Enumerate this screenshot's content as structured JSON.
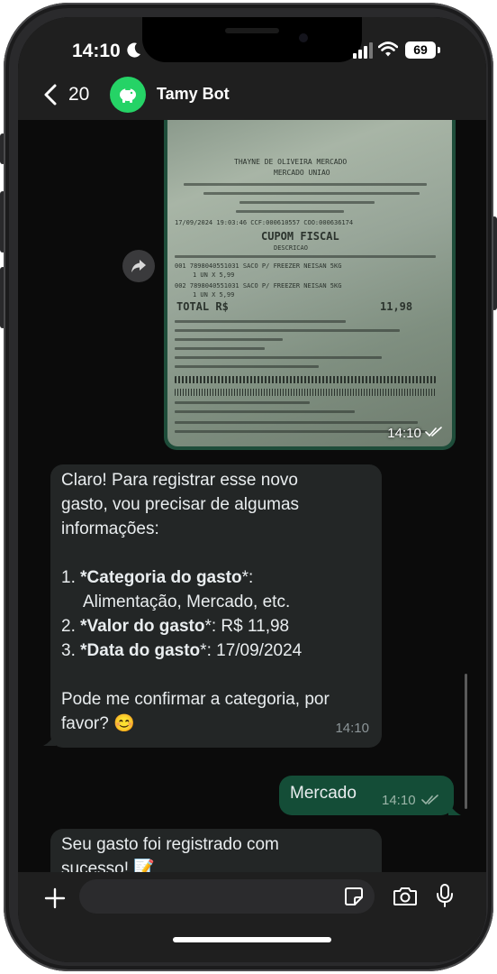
{
  "status_bar": {
    "time": "14:10",
    "battery": "69",
    "icons": [
      "moon-icon",
      "signal-icon",
      "wifi-icon",
      "battery-icon"
    ]
  },
  "header": {
    "back_count": "20",
    "contact_name": "Tamy Bot",
    "icons": [
      "chevron-left-icon",
      "piggy-bank-icon"
    ]
  },
  "messages": {
    "image": {
      "time": "14:10",
      "status": "read"
    },
    "bot_reply_1": {
      "intro_1": "Claro! Para registrar esse novo",
      "intro_2": "gasto, vou precisar de algumas",
      "intro_3": "informações:",
      "item1_num": "1.",
      "item1_label": "*Categoria do gasto",
      "item1_suffix": "*:",
      "item1_detail": "Alimentação, Mercado, etc.",
      "item2_num": "2.",
      "item2_label": "*Valor do gasto",
      "item2_suffix": "*: R$ 11,98",
      "item3_num": "3.",
      "item3_label": "*Data do gasto",
      "item3_suffix": "*: 17/09/2024",
      "question_1": "Pode me confirmar a categoria, por",
      "question_2": "favor? 😊",
      "time": "14:10"
    },
    "user_reply": {
      "text": "Mercado",
      "time": "14:10",
      "status": "read"
    },
    "bot_reply_2": {
      "line_1": "Seu gasto foi registrado com",
      "line_2": "sucesso! 📝"
    }
  },
  "receipt": {
    "store": "THAYNE DE OLIVEIRA MERCADO",
    "subtitle": "MERCADO UNIAO",
    "date_line": "17/09/2024 19:03:46 CCF:000610557 COO:000636174",
    "title": "CUPOM FISCAL",
    "desc": "DESCRICAO",
    "item_1": "001 7898040551031 SACO P/ FREEZER NEISAN 5KG",
    "item_1_qty": "1 UN X 5,99",
    "item_2": "002 7898040551031 SACO P/ FREEZER NEISAN 5KG",
    "item_2_qty": "1 UN X 5,99",
    "total_label": "TOTAL R$",
    "total_value": "11,98"
  },
  "input_bar": {
    "icons": [
      "plus-icon",
      "sticker-icon",
      "camera-icon",
      "microphone-icon"
    ]
  }
}
